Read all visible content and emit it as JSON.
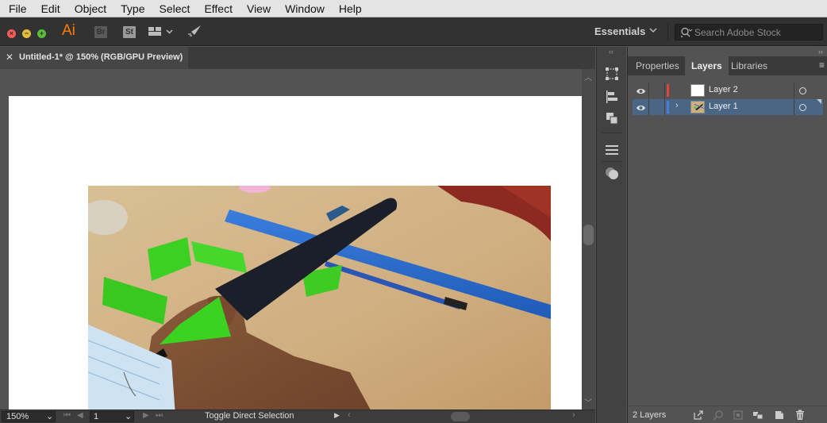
{
  "menu": [
    "File",
    "Edit",
    "Object",
    "Type",
    "Select",
    "Effect",
    "View",
    "Window",
    "Help"
  ],
  "app": {
    "logo": "Ai",
    "bridge": "Br",
    "stock": "St",
    "workspace": "Essentials",
    "search_placeholder": "Search Adobe Stock"
  },
  "document": {
    "tab_title": "Untitled-1* @ 150% (RGB/GPU Preview)"
  },
  "status": {
    "zoom": "150%",
    "artboard": "1",
    "tool_label": "Toggle Direct Selection"
  },
  "panel": {
    "tabs": [
      "Properties",
      "Layers",
      "Libraries"
    ],
    "active_tab": "Layers",
    "layers": [
      {
        "name": "Layer 2",
        "color": "#e0443e",
        "selected": false
      },
      {
        "name": "Layer 1",
        "color": "#4a7bd6",
        "selected": true
      }
    ],
    "footer_count": "2 Layers"
  },
  "colors": {
    "accent_orange": "#ff7c00",
    "selection_blue": "#4a6685",
    "panel_bg": "#535353"
  }
}
